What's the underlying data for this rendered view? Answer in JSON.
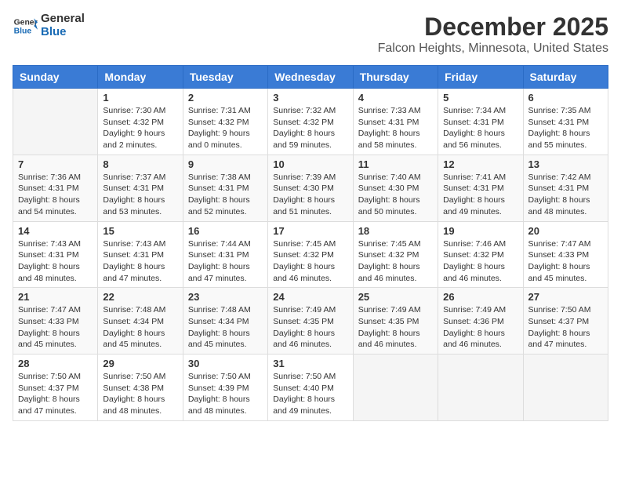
{
  "logo": {
    "line1": "General",
    "line2": "Blue"
  },
  "title": "December 2025",
  "subtitle": "Falcon Heights, Minnesota, United States",
  "weekdays": [
    "Sunday",
    "Monday",
    "Tuesday",
    "Wednesday",
    "Thursday",
    "Friday",
    "Saturday"
  ],
  "weeks": [
    [
      {
        "day": "",
        "info": ""
      },
      {
        "day": "1",
        "info": "Sunrise: 7:30 AM\nSunset: 4:32 PM\nDaylight: 9 hours\nand 2 minutes."
      },
      {
        "day": "2",
        "info": "Sunrise: 7:31 AM\nSunset: 4:32 PM\nDaylight: 9 hours\nand 0 minutes."
      },
      {
        "day": "3",
        "info": "Sunrise: 7:32 AM\nSunset: 4:32 PM\nDaylight: 8 hours\nand 59 minutes."
      },
      {
        "day": "4",
        "info": "Sunrise: 7:33 AM\nSunset: 4:31 PM\nDaylight: 8 hours\nand 58 minutes."
      },
      {
        "day": "5",
        "info": "Sunrise: 7:34 AM\nSunset: 4:31 PM\nDaylight: 8 hours\nand 56 minutes."
      },
      {
        "day": "6",
        "info": "Sunrise: 7:35 AM\nSunset: 4:31 PM\nDaylight: 8 hours\nand 55 minutes."
      }
    ],
    [
      {
        "day": "7",
        "info": "Sunrise: 7:36 AM\nSunset: 4:31 PM\nDaylight: 8 hours\nand 54 minutes."
      },
      {
        "day": "8",
        "info": "Sunrise: 7:37 AM\nSunset: 4:31 PM\nDaylight: 8 hours\nand 53 minutes."
      },
      {
        "day": "9",
        "info": "Sunrise: 7:38 AM\nSunset: 4:31 PM\nDaylight: 8 hours\nand 52 minutes."
      },
      {
        "day": "10",
        "info": "Sunrise: 7:39 AM\nSunset: 4:30 PM\nDaylight: 8 hours\nand 51 minutes."
      },
      {
        "day": "11",
        "info": "Sunrise: 7:40 AM\nSunset: 4:30 PM\nDaylight: 8 hours\nand 50 minutes."
      },
      {
        "day": "12",
        "info": "Sunrise: 7:41 AM\nSunset: 4:31 PM\nDaylight: 8 hours\nand 49 minutes."
      },
      {
        "day": "13",
        "info": "Sunrise: 7:42 AM\nSunset: 4:31 PM\nDaylight: 8 hours\nand 48 minutes."
      }
    ],
    [
      {
        "day": "14",
        "info": "Sunrise: 7:43 AM\nSunset: 4:31 PM\nDaylight: 8 hours\nand 48 minutes."
      },
      {
        "day": "15",
        "info": "Sunrise: 7:43 AM\nSunset: 4:31 PM\nDaylight: 8 hours\nand 47 minutes."
      },
      {
        "day": "16",
        "info": "Sunrise: 7:44 AM\nSunset: 4:31 PM\nDaylight: 8 hours\nand 47 minutes."
      },
      {
        "day": "17",
        "info": "Sunrise: 7:45 AM\nSunset: 4:32 PM\nDaylight: 8 hours\nand 46 minutes."
      },
      {
        "day": "18",
        "info": "Sunrise: 7:45 AM\nSunset: 4:32 PM\nDaylight: 8 hours\nand 46 minutes."
      },
      {
        "day": "19",
        "info": "Sunrise: 7:46 AM\nSunset: 4:32 PM\nDaylight: 8 hours\nand 46 minutes."
      },
      {
        "day": "20",
        "info": "Sunrise: 7:47 AM\nSunset: 4:33 PM\nDaylight: 8 hours\nand 45 minutes."
      }
    ],
    [
      {
        "day": "21",
        "info": "Sunrise: 7:47 AM\nSunset: 4:33 PM\nDaylight: 8 hours\nand 45 minutes."
      },
      {
        "day": "22",
        "info": "Sunrise: 7:48 AM\nSunset: 4:34 PM\nDaylight: 8 hours\nand 45 minutes."
      },
      {
        "day": "23",
        "info": "Sunrise: 7:48 AM\nSunset: 4:34 PM\nDaylight: 8 hours\nand 45 minutes."
      },
      {
        "day": "24",
        "info": "Sunrise: 7:49 AM\nSunset: 4:35 PM\nDaylight: 8 hours\nand 46 minutes."
      },
      {
        "day": "25",
        "info": "Sunrise: 7:49 AM\nSunset: 4:35 PM\nDaylight: 8 hours\nand 46 minutes."
      },
      {
        "day": "26",
        "info": "Sunrise: 7:49 AM\nSunset: 4:36 PM\nDaylight: 8 hours\nand 46 minutes."
      },
      {
        "day": "27",
        "info": "Sunrise: 7:50 AM\nSunset: 4:37 PM\nDaylight: 8 hours\nand 47 minutes."
      }
    ],
    [
      {
        "day": "28",
        "info": "Sunrise: 7:50 AM\nSunset: 4:37 PM\nDaylight: 8 hours\nand 47 minutes."
      },
      {
        "day": "29",
        "info": "Sunrise: 7:50 AM\nSunset: 4:38 PM\nDaylight: 8 hours\nand 48 minutes."
      },
      {
        "day": "30",
        "info": "Sunrise: 7:50 AM\nSunset: 4:39 PM\nDaylight: 8 hours\nand 48 minutes."
      },
      {
        "day": "31",
        "info": "Sunrise: 7:50 AM\nSunset: 4:40 PM\nDaylight: 8 hours\nand 49 minutes."
      },
      {
        "day": "",
        "info": ""
      },
      {
        "day": "",
        "info": ""
      },
      {
        "day": "",
        "info": ""
      }
    ]
  ]
}
